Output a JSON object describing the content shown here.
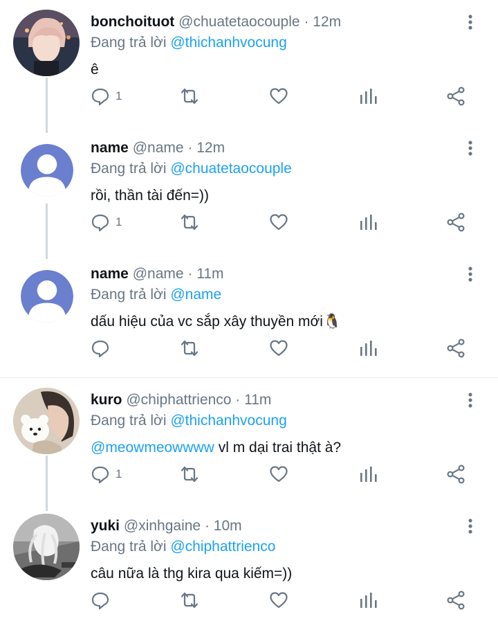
{
  "replying_prefix": "Đang trả lời",
  "tweets": [
    {
      "name": "bonchoituot",
      "handle": "@chuatetaocouple",
      "time": "12m",
      "replying_to": "@thichanhvocung",
      "text": "ê",
      "reply_count": "1"
    },
    {
      "name": "name",
      "handle": "@name",
      "time": "12m",
      "replying_to": "@chuatetaocouple",
      "text": "rồi, thần tài đến=))",
      "reply_count": "1"
    },
    {
      "name": "name",
      "handle": "@name",
      "time": "11m",
      "replying_to": "@name",
      "text": "dấu hiệu của vc sắp xây thuyền mới🐧",
      "reply_count": ""
    },
    {
      "name": "kuro",
      "handle": "@chiphattrienco",
      "time": "11m",
      "replying_to": "@thichanhvocung",
      "text_mention": "@meowmeowwww",
      "text": " vl m dại trai thật à?",
      "reply_count": "1"
    },
    {
      "name": "yuki",
      "handle": "@xinhgaine",
      "time": "10m",
      "replying_to": "@chiphattrienco",
      "text": "câu nữa là thg kira qua kiếm=))",
      "reply_count": ""
    }
  ],
  "colors": {
    "link": "#1da1f2",
    "secondary": "#687684",
    "primary": "#0f1419",
    "thread_line": "#cfd9de",
    "default_avatar": "#6b7fcf"
  }
}
